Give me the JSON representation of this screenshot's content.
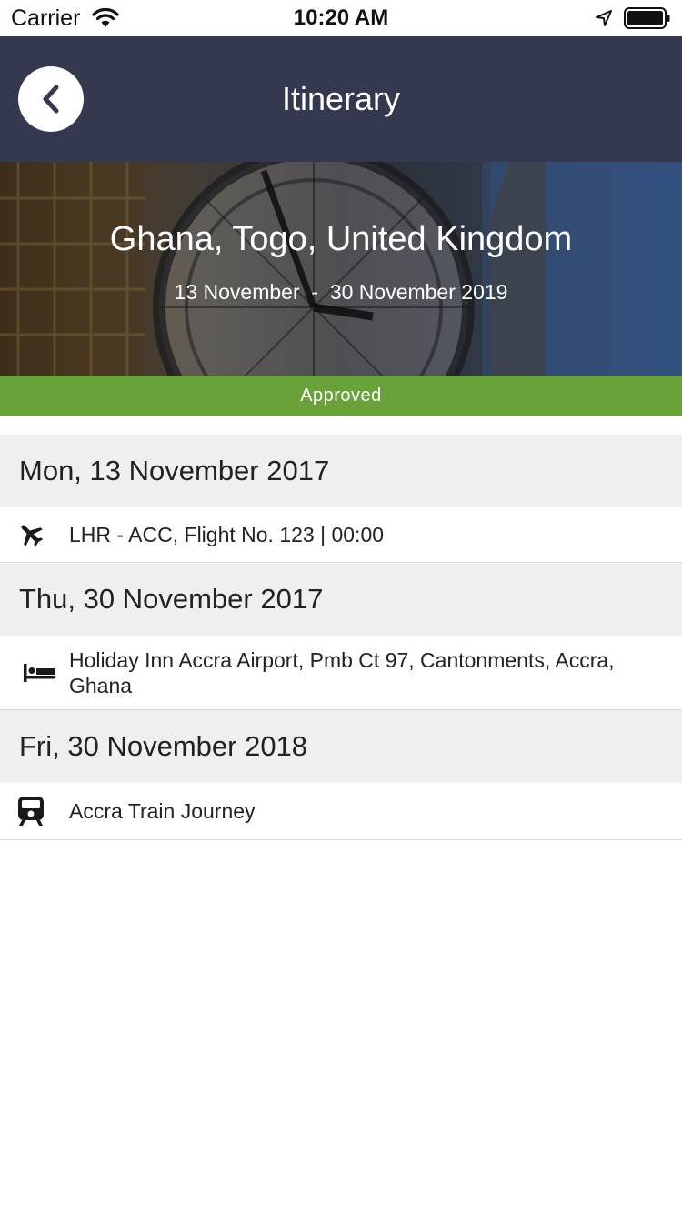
{
  "status_bar": {
    "carrier": "Carrier",
    "time": "10:20 AM"
  },
  "nav": {
    "title": "Itinerary"
  },
  "hero": {
    "destinations": "Ghana, Togo, United Kingdom",
    "date_range": "13 November  -  30 November 2019"
  },
  "status": {
    "label": "Approved",
    "color": "#6aa23a"
  },
  "days": [
    {
      "date": "Mon, 13 November 2017",
      "items": [
        {
          "icon": "airplane-icon",
          "text": "LHR - ACC, Flight No. 123 | 00:00"
        }
      ]
    },
    {
      "date": "Thu, 30 November 2017",
      "items": [
        {
          "icon": "bed-icon",
          "text": "Holiday Inn Accra Airport, Pmb Ct 97, Cantonments, Accra, Ghana"
        }
      ]
    },
    {
      "date": "Fri, 30 November 2018",
      "items": [
        {
          "icon": "train-icon",
          "text": "Accra Train Journey"
        }
      ]
    }
  ],
  "colors": {
    "nav_background": "#353950",
    "day_header_background": "#efefef"
  }
}
